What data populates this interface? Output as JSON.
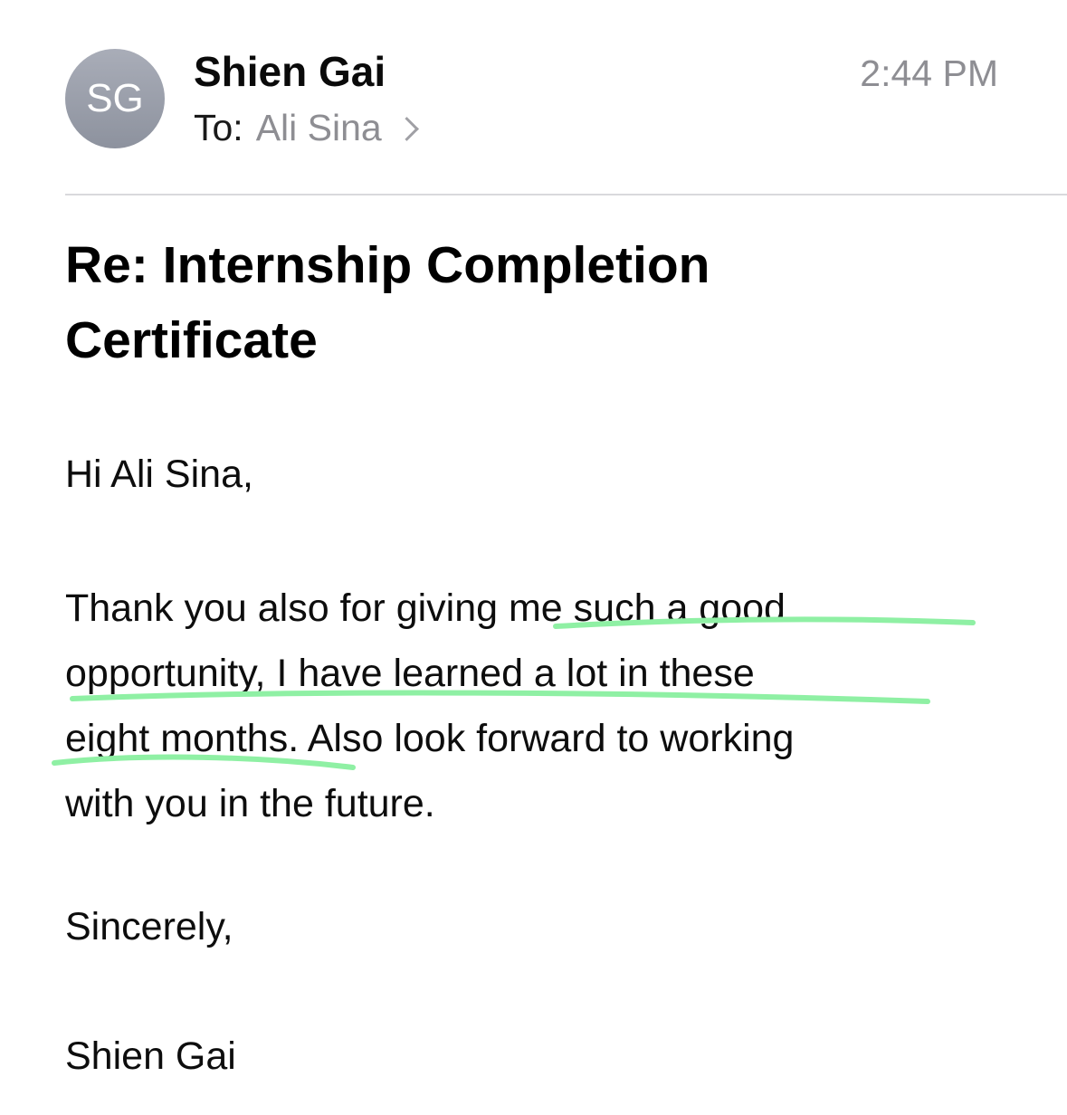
{
  "header": {
    "avatar_initials": "SG",
    "sender_name": "Shien Gai",
    "to_label": "To:",
    "to_name": "Ali Sina",
    "time": "2:44 PM"
  },
  "email": {
    "subject_line_1": "Re: Internship Completion",
    "subject_line_2": "Certificate",
    "greeting": "Hi Ali Sina,",
    "body_lines": [
      "Thank you also for giving me such a good",
      "opportunity, I have learned a lot in these",
      "eight months. Also look forward to working",
      "with you in the future."
    ],
    "closing": "Sincerely,",
    "signature": "Shien Gai"
  },
  "colors": {
    "highlight": "#8ff0a4",
    "avatar": "#9ca0ab",
    "secondary_text": "#8e8e93"
  }
}
